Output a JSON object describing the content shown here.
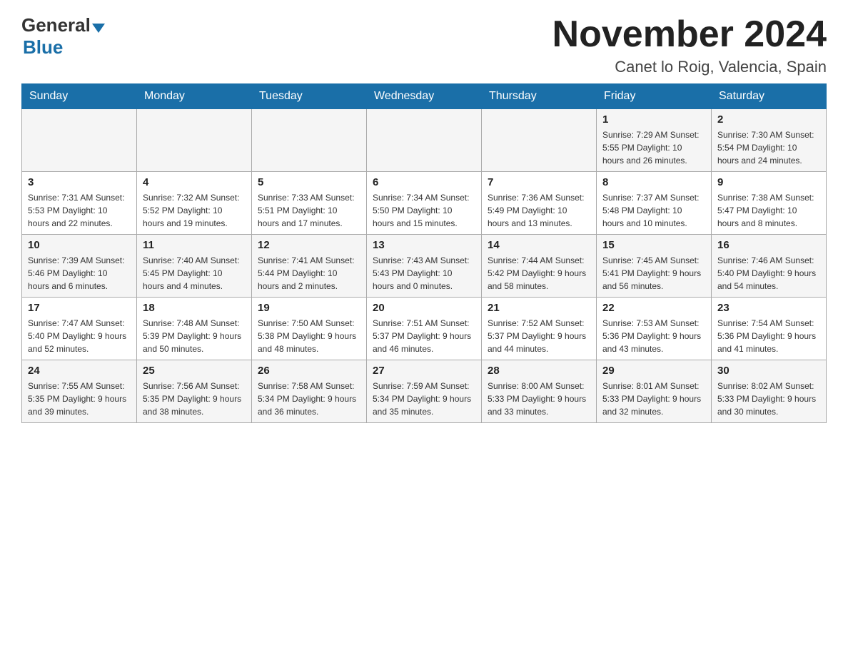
{
  "header": {
    "month_title": "November 2024",
    "location": "Canet lo Roig, Valencia, Spain",
    "logo_general": "General",
    "logo_blue": "Blue"
  },
  "days_of_week": [
    "Sunday",
    "Monday",
    "Tuesday",
    "Wednesday",
    "Thursday",
    "Friday",
    "Saturday"
  ],
  "weeks": [
    [
      {
        "day": "",
        "info": ""
      },
      {
        "day": "",
        "info": ""
      },
      {
        "day": "",
        "info": ""
      },
      {
        "day": "",
        "info": ""
      },
      {
        "day": "",
        "info": ""
      },
      {
        "day": "1",
        "info": "Sunrise: 7:29 AM\nSunset: 5:55 PM\nDaylight: 10 hours and 26 minutes."
      },
      {
        "day": "2",
        "info": "Sunrise: 7:30 AM\nSunset: 5:54 PM\nDaylight: 10 hours and 24 minutes."
      }
    ],
    [
      {
        "day": "3",
        "info": "Sunrise: 7:31 AM\nSunset: 5:53 PM\nDaylight: 10 hours and 22 minutes."
      },
      {
        "day": "4",
        "info": "Sunrise: 7:32 AM\nSunset: 5:52 PM\nDaylight: 10 hours and 19 minutes."
      },
      {
        "day": "5",
        "info": "Sunrise: 7:33 AM\nSunset: 5:51 PM\nDaylight: 10 hours and 17 minutes."
      },
      {
        "day": "6",
        "info": "Sunrise: 7:34 AM\nSunset: 5:50 PM\nDaylight: 10 hours and 15 minutes."
      },
      {
        "day": "7",
        "info": "Sunrise: 7:36 AM\nSunset: 5:49 PM\nDaylight: 10 hours and 13 minutes."
      },
      {
        "day": "8",
        "info": "Sunrise: 7:37 AM\nSunset: 5:48 PM\nDaylight: 10 hours and 10 minutes."
      },
      {
        "day": "9",
        "info": "Sunrise: 7:38 AM\nSunset: 5:47 PM\nDaylight: 10 hours and 8 minutes."
      }
    ],
    [
      {
        "day": "10",
        "info": "Sunrise: 7:39 AM\nSunset: 5:46 PM\nDaylight: 10 hours and 6 minutes."
      },
      {
        "day": "11",
        "info": "Sunrise: 7:40 AM\nSunset: 5:45 PM\nDaylight: 10 hours and 4 minutes."
      },
      {
        "day": "12",
        "info": "Sunrise: 7:41 AM\nSunset: 5:44 PM\nDaylight: 10 hours and 2 minutes."
      },
      {
        "day": "13",
        "info": "Sunrise: 7:43 AM\nSunset: 5:43 PM\nDaylight: 10 hours and 0 minutes."
      },
      {
        "day": "14",
        "info": "Sunrise: 7:44 AM\nSunset: 5:42 PM\nDaylight: 9 hours and 58 minutes."
      },
      {
        "day": "15",
        "info": "Sunrise: 7:45 AM\nSunset: 5:41 PM\nDaylight: 9 hours and 56 minutes."
      },
      {
        "day": "16",
        "info": "Sunrise: 7:46 AM\nSunset: 5:40 PM\nDaylight: 9 hours and 54 minutes."
      }
    ],
    [
      {
        "day": "17",
        "info": "Sunrise: 7:47 AM\nSunset: 5:40 PM\nDaylight: 9 hours and 52 minutes."
      },
      {
        "day": "18",
        "info": "Sunrise: 7:48 AM\nSunset: 5:39 PM\nDaylight: 9 hours and 50 minutes."
      },
      {
        "day": "19",
        "info": "Sunrise: 7:50 AM\nSunset: 5:38 PM\nDaylight: 9 hours and 48 minutes."
      },
      {
        "day": "20",
        "info": "Sunrise: 7:51 AM\nSunset: 5:37 PM\nDaylight: 9 hours and 46 minutes."
      },
      {
        "day": "21",
        "info": "Sunrise: 7:52 AM\nSunset: 5:37 PM\nDaylight: 9 hours and 44 minutes."
      },
      {
        "day": "22",
        "info": "Sunrise: 7:53 AM\nSunset: 5:36 PM\nDaylight: 9 hours and 43 minutes."
      },
      {
        "day": "23",
        "info": "Sunrise: 7:54 AM\nSunset: 5:36 PM\nDaylight: 9 hours and 41 minutes."
      }
    ],
    [
      {
        "day": "24",
        "info": "Sunrise: 7:55 AM\nSunset: 5:35 PM\nDaylight: 9 hours and 39 minutes."
      },
      {
        "day": "25",
        "info": "Sunrise: 7:56 AM\nSunset: 5:35 PM\nDaylight: 9 hours and 38 minutes."
      },
      {
        "day": "26",
        "info": "Sunrise: 7:58 AM\nSunset: 5:34 PM\nDaylight: 9 hours and 36 minutes."
      },
      {
        "day": "27",
        "info": "Sunrise: 7:59 AM\nSunset: 5:34 PM\nDaylight: 9 hours and 35 minutes."
      },
      {
        "day": "28",
        "info": "Sunrise: 8:00 AM\nSunset: 5:33 PM\nDaylight: 9 hours and 33 minutes."
      },
      {
        "day": "29",
        "info": "Sunrise: 8:01 AM\nSunset: 5:33 PM\nDaylight: 9 hours and 32 minutes."
      },
      {
        "day": "30",
        "info": "Sunrise: 8:02 AM\nSunset: 5:33 PM\nDaylight: 9 hours and 30 minutes."
      }
    ]
  ]
}
